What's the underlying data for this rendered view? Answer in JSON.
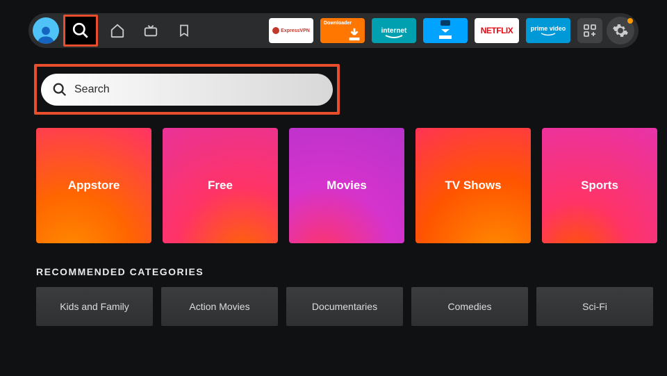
{
  "nav": {
    "search_selected": true
  },
  "apps": {
    "expressvpn": "ExpressVPN",
    "downloader": "Downloader",
    "internet": "internet",
    "netflix": "NETFLIX",
    "prime": "prime video"
  },
  "search": {
    "placeholder": "Search"
  },
  "tiles": [
    {
      "label": "Appstore"
    },
    {
      "label": "Free"
    },
    {
      "label": "Movies"
    },
    {
      "label": "TV Shows"
    },
    {
      "label": "Sports"
    }
  ],
  "recommended": {
    "header": "RECOMMENDED CATEGORIES",
    "items": [
      "Kids and Family",
      "Action Movies",
      "Documentaries",
      "Comedies",
      "Sci-Fi"
    ]
  },
  "colors": {
    "highlight": "#e94e2c",
    "background": "#0f1113",
    "notification": "#ff9900"
  }
}
